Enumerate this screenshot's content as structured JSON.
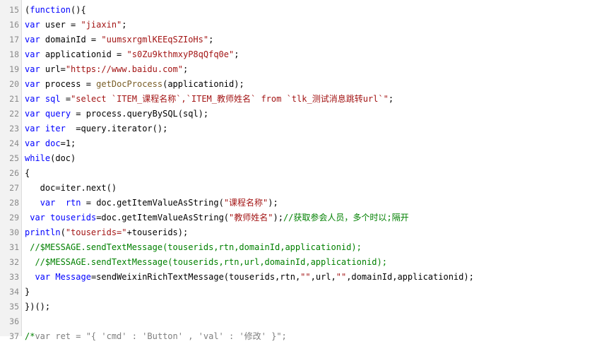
{
  "editor": {
    "lines": [
      {
        "num": "15",
        "segments": [
          {
            "t": "(",
            "c": "p"
          },
          {
            "t": "function",
            "c": "kw"
          },
          {
            "t": "(){",
            "c": "p"
          }
        ]
      },
      {
        "num": "16",
        "segments": [
          {
            "t": "var",
            "c": "kw"
          },
          {
            "t": " user = ",
            "c": "p"
          },
          {
            "t": "\"jiaxin\"",
            "c": "str"
          },
          {
            "t": ";",
            "c": "p"
          }
        ]
      },
      {
        "num": "17",
        "segments": [
          {
            "t": "var",
            "c": "kw"
          },
          {
            "t": " domainId = ",
            "c": "p"
          },
          {
            "t": "\"uumsxrgmlKEEqSZIoHs\"",
            "c": "str"
          },
          {
            "t": ";",
            "c": "p"
          }
        ]
      },
      {
        "num": "18",
        "segments": [
          {
            "t": "var",
            "c": "kw"
          },
          {
            "t": " applicationid = ",
            "c": "p"
          },
          {
            "t": "\"s0Zu9kthmxyP8qQfq0e\"",
            "c": "str"
          },
          {
            "t": ";",
            "c": "p"
          }
        ]
      },
      {
        "num": "19",
        "segments": [
          {
            "t": "var",
            "c": "kw"
          },
          {
            "t": " url=",
            "c": "p"
          },
          {
            "t": "\"https://www.baidu.com\"",
            "c": "str"
          },
          {
            "t": ";",
            "c": "p"
          }
        ]
      },
      {
        "num": "20",
        "segments": [
          {
            "t": "var",
            "c": "kw"
          },
          {
            "t": " process = ",
            "c": "p"
          },
          {
            "t": "getDocProcess",
            "c": "fn"
          },
          {
            "t": "(applicationid);",
            "c": "p"
          }
        ]
      },
      {
        "num": "21",
        "segments": [
          {
            "t": "var",
            "c": "kw"
          },
          {
            "t": " ",
            "c": "p"
          },
          {
            "t": "sql",
            "c": "id"
          },
          {
            "t": " =",
            "c": "p"
          },
          {
            "t": "\"select `ITEM_课程名称`,`ITEM_教师姓名` from `tlk_测试消息跳转url`\"",
            "c": "str"
          },
          {
            "t": ";",
            "c": "p"
          }
        ]
      },
      {
        "num": "22",
        "segments": [
          {
            "t": "var",
            "c": "kw"
          },
          {
            "t": " ",
            "c": "p"
          },
          {
            "t": "query",
            "c": "id"
          },
          {
            "t": " = process.queryBySQL(sql);",
            "c": "p"
          }
        ]
      },
      {
        "num": "23",
        "segments": [
          {
            "t": "var",
            "c": "kw"
          },
          {
            "t": " ",
            "c": "p"
          },
          {
            "t": "iter",
            "c": "id"
          },
          {
            "t": "  =query.iterator();",
            "c": "p"
          }
        ]
      },
      {
        "num": "24",
        "segments": [
          {
            "t": "var",
            "c": "kw"
          },
          {
            "t": " ",
            "c": "p"
          },
          {
            "t": "doc",
            "c": "id"
          },
          {
            "t": "=1;",
            "c": "p"
          }
        ]
      },
      {
        "num": "25",
        "segments": [
          {
            "t": "while",
            "c": "kw"
          },
          {
            "t": "(doc)",
            "c": "p"
          }
        ]
      },
      {
        "num": "26",
        "segments": [
          {
            "t": "{",
            "c": "p"
          }
        ]
      },
      {
        "num": "27",
        "segments": [
          {
            "t": "   doc=iter.next()",
            "c": "p"
          }
        ]
      },
      {
        "num": "28",
        "segments": [
          {
            "t": "   ",
            "c": "p"
          },
          {
            "t": "var",
            "c": "kw"
          },
          {
            "t": "  ",
            "c": "p"
          },
          {
            "t": "rtn",
            "c": "id"
          },
          {
            "t": " = doc.getItemValueAsString(",
            "c": "p"
          },
          {
            "t": "\"课程名称\"",
            "c": "str"
          },
          {
            "t": ");",
            "c": "p"
          }
        ]
      },
      {
        "num": "29",
        "segments": [
          {
            "t": " ",
            "c": "p"
          },
          {
            "t": "var",
            "c": "kw"
          },
          {
            "t": " ",
            "c": "p"
          },
          {
            "t": "touserids",
            "c": "id"
          },
          {
            "t": "=doc.getItemValueAsString(",
            "c": "p"
          },
          {
            "t": "\"教师姓名\"",
            "c": "str"
          },
          {
            "t": ");",
            "c": "p"
          },
          {
            "t": "//获取参会人员，多个时以;隔开",
            "c": "cmt"
          }
        ]
      },
      {
        "num": "30",
        "segments": [
          {
            "t": "println",
            "c": "kw"
          },
          {
            "t": "(",
            "c": "p"
          },
          {
            "t": "\"touserids=\"",
            "c": "str"
          },
          {
            "t": "+touserids);",
            "c": "p"
          }
        ]
      },
      {
        "num": "31",
        "segments": [
          {
            "t": " //$MESSAGE.sendTextMessage(touserids,rtn,domainId,applicationid);",
            "c": "cmt"
          }
        ]
      },
      {
        "num": "32",
        "segments": [
          {
            "t": "  //$MESSAGE.sendTextMessage(touserids,rtn,url,domainId,applicationid);",
            "c": "cmt"
          }
        ]
      },
      {
        "num": "33",
        "segments": [
          {
            "t": "  ",
            "c": "p"
          },
          {
            "t": "var",
            "c": "kw"
          },
          {
            "t": " ",
            "c": "p"
          },
          {
            "t": "Message",
            "c": "id"
          },
          {
            "t": "=sendWeixinRichTextMessage(touserids,rtn,",
            "c": "p"
          },
          {
            "t": "\"\"",
            "c": "str"
          },
          {
            "t": ",url,",
            "c": "p"
          },
          {
            "t": "\"\"",
            "c": "str"
          },
          {
            "t": ",domainId,applicationid);",
            "c": "p"
          }
        ]
      },
      {
        "num": "34",
        "segments": [
          {
            "t": "}",
            "c": "p"
          }
        ]
      },
      {
        "num": "35",
        "segments": [
          {
            "t": "})();",
            "c": "p"
          }
        ]
      },
      {
        "num": "36",
        "segments": []
      },
      {
        "num": "37",
        "segments": [
          {
            "t": "/*",
            "c": "cmt"
          },
          {
            "t": "var ret = \"{ 'cmd' : 'Button' , 'val' : '修改' }\";",
            "c": "cm-muted"
          }
        ]
      }
    ]
  }
}
